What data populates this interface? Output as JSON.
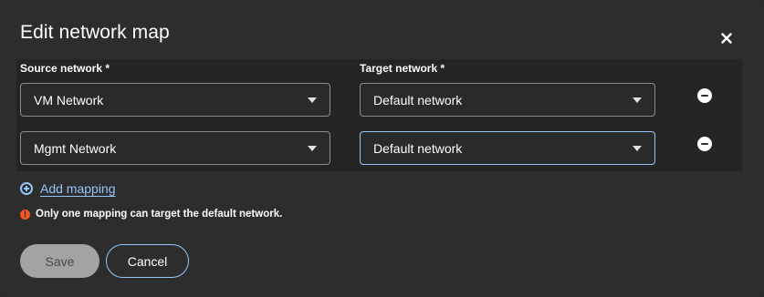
{
  "modal": {
    "title": "Edit network map",
    "close_icon": "close-icon"
  },
  "columns": {
    "source_label": "Source network *",
    "target_label": "Target network *"
  },
  "mappings": [
    {
      "source": "VM Network",
      "target": "Default network"
    },
    {
      "source": "Mgmt Network",
      "target": "Default network"
    }
  ],
  "add_mapping": {
    "label": "Add mapping",
    "icon": "plus-circle-icon"
  },
  "error": {
    "icon": "exclamation-circle-icon",
    "text": "Only one mapping can target the default network."
  },
  "footer": {
    "save_label": "Save",
    "cancel_label": "Cancel"
  },
  "colors": {
    "accent": "#92c5f9",
    "danger": "#f0561d",
    "background": "#2d2d2d"
  }
}
